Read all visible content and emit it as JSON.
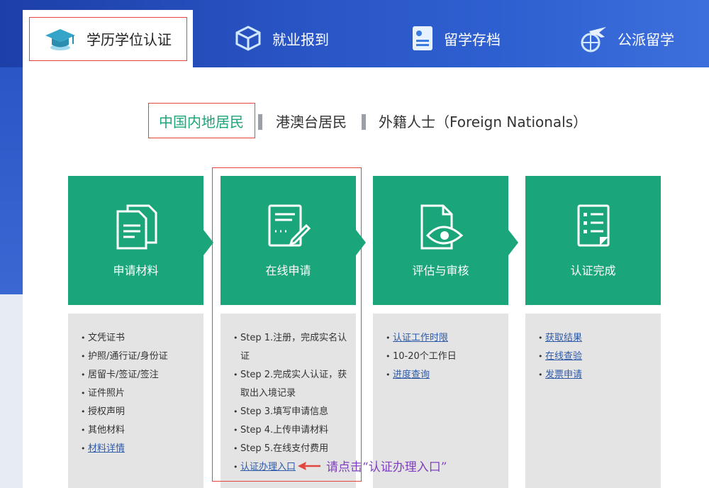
{
  "nav": {
    "tabs": [
      {
        "label": "学历学位认证",
        "icon": "graduation-cap-icon"
      },
      {
        "label": "就业报到",
        "icon": "cube-icon"
      },
      {
        "label": "留学存档",
        "icon": "document-card-icon"
      },
      {
        "label": "公派留学",
        "icon": "plane-globe-icon"
      }
    ]
  },
  "subtabs": [
    "中国内地居民",
    "港澳台居民",
    "外籍人士（Foreign Nationals）"
  ],
  "steps": [
    {
      "label": "申请材料",
      "icon": "documents-icon"
    },
    {
      "label": "在线申请",
      "icon": "form-edit-icon"
    },
    {
      "label": "评估与审核",
      "icon": "file-eye-icon"
    },
    {
      "label": "认证完成",
      "icon": "checklist-icon"
    }
  ],
  "lists": {
    "materials": [
      "文凭证书",
      "护照/通行证/身份证",
      "居留卡/签证/签注",
      "证件照片",
      "授权声明",
      "其他材料"
    ],
    "materials_link": "材料详情",
    "online": [
      "Step 1.注册，完成实名认证",
      "Step 2.完成实人认证，获取出入境记录",
      "Step 3.填写申请信息",
      "Step 4.上传申请材料",
      "Step 5.在线支付费用"
    ],
    "online_link": "认证办理入口",
    "review_link1": "认证工作时限",
    "review_text": "10-20个工作日",
    "review_link2": "进度查询",
    "done": [
      "获取结果",
      "在线查验",
      "发票申请"
    ]
  },
  "annotation": "请点击“认证办理入口”",
  "colors": {
    "accent": "#1aa57a",
    "banner": "#2a56c6",
    "highlight": "#e2463f",
    "note": "#7f3fbf"
  }
}
